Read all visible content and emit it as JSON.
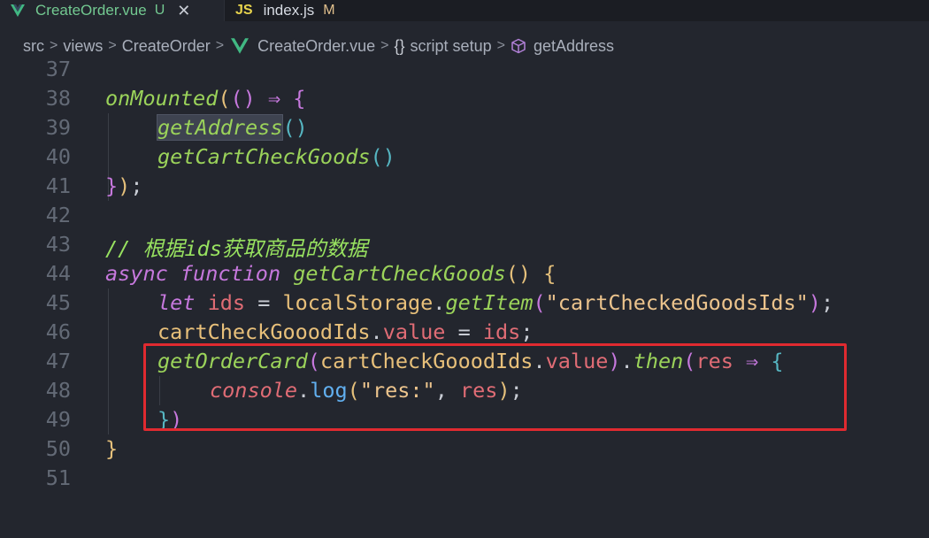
{
  "tabs": [
    {
      "label": "CreateOrder.vue",
      "status": "U",
      "icon": "vue-icon",
      "active": true
    },
    {
      "label": "index.js",
      "status": "M",
      "icon": "js-icon",
      "active": false
    }
  ],
  "breadcrumb": {
    "items": [
      "src",
      "views",
      "CreateOrder",
      "CreateOrder.vue",
      "script setup",
      "getAddress"
    ],
    "separator": ">",
    "braces": "{}"
  },
  "editor": {
    "line_numbers": [
      "37",
      "38",
      "39",
      "40",
      "41",
      "42",
      "43",
      "44",
      "45",
      "46",
      "47",
      "48",
      "49",
      "50",
      "51"
    ],
    "lines": {
      "l38": [
        "onMounted",
        "(",
        "(",
        ")",
        " ⇒ ",
        "{"
      ],
      "l39": [
        "getAddress",
        "()"
      ],
      "l40": [
        "getCartCheckGoods",
        "()"
      ],
      "l41": [
        "}",
        ")",
        ";"
      ],
      "l43": "// 根据ids获取商品的数据",
      "l44": [
        "async",
        " ",
        "function",
        " ",
        "getCartCheckGoods",
        "()",
        " ",
        "{"
      ],
      "l45": [
        "let",
        " ",
        "ids",
        " = ",
        "localStorage",
        ".",
        "getItem",
        "(",
        "\"cartCheckedGoodsIds\"",
        ")",
        ";"
      ],
      "l46": [
        "cartCheckGooodIds",
        ".",
        "value",
        " = ",
        "ids",
        ";"
      ],
      "l47": [
        "getOrderCard",
        "(",
        "cartCheckGooodIds",
        ".",
        "value",
        ")",
        ".",
        "then",
        "(",
        "res",
        " ⇒ ",
        "{"
      ],
      "l48": [
        "console",
        ".",
        "log",
        "(",
        "\"res:\"",
        ", ",
        "res",
        ")",
        ";"
      ],
      "l49": [
        "}",
        ")"
      ],
      "l50": [
        "}"
      ]
    }
  },
  "colors": {
    "background": "#23262e",
    "highlight_box": "#e02a30",
    "function": "#9bd35a",
    "keyword": "#c678dd"
  }
}
